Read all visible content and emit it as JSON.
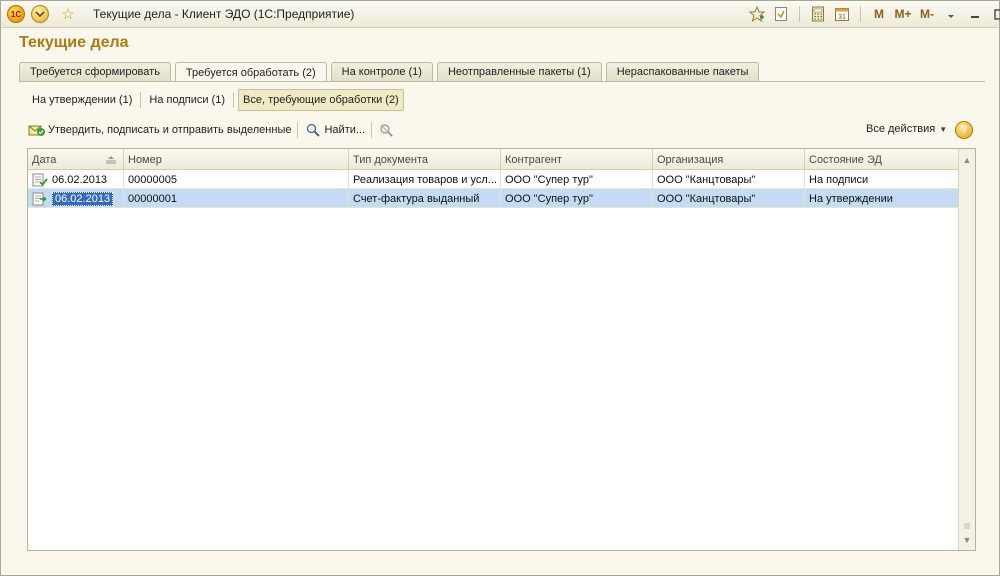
{
  "window": {
    "title": "Текущие дела - Клиент ЭДО  (1С:Предприятие)",
    "logo_text": "1С",
    "m_buttons": [
      "M",
      "M+",
      "M-"
    ]
  },
  "form": {
    "title": "Текущие дела"
  },
  "tabs": [
    {
      "label": "Требуется сформировать",
      "active": false
    },
    {
      "label": "Требуется обработать (2)",
      "active": true
    },
    {
      "label": "На контроле (1)",
      "active": false
    },
    {
      "label": "Неотправленные пакеты (1)",
      "active": false
    },
    {
      "label": "Нераспакованные пакеты",
      "active": false
    }
  ],
  "subtabs": [
    {
      "label": "На утверждении (1)",
      "active": false
    },
    {
      "label": "На подписи (1)",
      "active": false
    },
    {
      "label": "Все, требующие обработки (2)",
      "active": true
    }
  ],
  "toolbar": {
    "approve_label": "Утвердить, подписать и отправить выделенные",
    "find_label": "Найти...",
    "all_actions_label": "Все действия",
    "help_label": "?"
  },
  "table": {
    "columns": [
      "Дата",
      "Номер",
      "Тип документа",
      "Контрагент",
      "Организация",
      "Состояние ЭД"
    ],
    "rows": [
      {
        "date": "06.02.2013",
        "number": "00000005",
        "doc_type": "Реализация товаров и усл...",
        "counterparty": "ООО \"Супер тур\"",
        "organization": "ООО \"Канцтовары\"",
        "state": "На подписи",
        "selected": false
      },
      {
        "date": "06.02.2013",
        "number": "00000001",
        "doc_type": "Счет-фактура выданный",
        "counterparty": "ООО \"Супер тур\"",
        "organization": "ООО \"Канцтовары\"",
        "state": "На утверждении",
        "selected": true
      }
    ]
  },
  "icons": {
    "logo": "1c-logo-icon",
    "menu": "main-menu-icon",
    "favorite": "star-icon",
    "approve": "approve-send-icon",
    "find": "search-icon",
    "clear_find": "clear-search-icon",
    "help": "help-icon",
    "doc": "document-check-icon"
  },
  "colors": {
    "title_accent": "#b07a12",
    "selection": "#c3dcf4",
    "background": "#faf8ec"
  }
}
